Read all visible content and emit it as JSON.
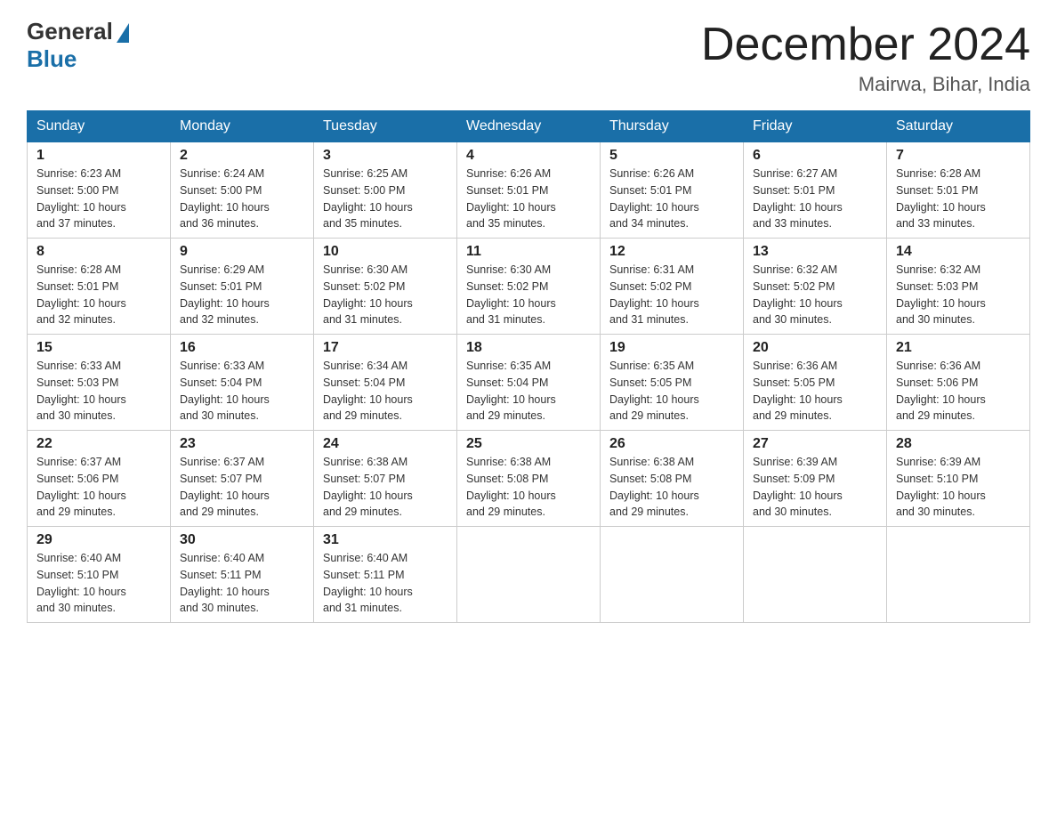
{
  "header": {
    "logo_general": "General",
    "logo_blue": "Blue",
    "month_title": "December 2024",
    "location": "Mairwa, Bihar, India"
  },
  "weekdays": [
    "Sunday",
    "Monday",
    "Tuesday",
    "Wednesday",
    "Thursday",
    "Friday",
    "Saturday"
  ],
  "weeks": [
    [
      {
        "day": "1",
        "sunrise": "6:23 AM",
        "sunset": "5:00 PM",
        "daylight": "10 hours and 37 minutes."
      },
      {
        "day": "2",
        "sunrise": "6:24 AM",
        "sunset": "5:00 PM",
        "daylight": "10 hours and 36 minutes."
      },
      {
        "day": "3",
        "sunrise": "6:25 AM",
        "sunset": "5:00 PM",
        "daylight": "10 hours and 35 minutes."
      },
      {
        "day": "4",
        "sunrise": "6:26 AM",
        "sunset": "5:01 PM",
        "daylight": "10 hours and 35 minutes."
      },
      {
        "day": "5",
        "sunrise": "6:26 AM",
        "sunset": "5:01 PM",
        "daylight": "10 hours and 34 minutes."
      },
      {
        "day": "6",
        "sunrise": "6:27 AM",
        "sunset": "5:01 PM",
        "daylight": "10 hours and 33 minutes."
      },
      {
        "day": "7",
        "sunrise": "6:28 AM",
        "sunset": "5:01 PM",
        "daylight": "10 hours and 33 minutes."
      }
    ],
    [
      {
        "day": "8",
        "sunrise": "6:28 AM",
        "sunset": "5:01 PM",
        "daylight": "10 hours and 32 minutes."
      },
      {
        "day": "9",
        "sunrise": "6:29 AM",
        "sunset": "5:01 PM",
        "daylight": "10 hours and 32 minutes."
      },
      {
        "day": "10",
        "sunrise": "6:30 AM",
        "sunset": "5:02 PM",
        "daylight": "10 hours and 31 minutes."
      },
      {
        "day": "11",
        "sunrise": "6:30 AM",
        "sunset": "5:02 PM",
        "daylight": "10 hours and 31 minutes."
      },
      {
        "day": "12",
        "sunrise": "6:31 AM",
        "sunset": "5:02 PM",
        "daylight": "10 hours and 31 minutes."
      },
      {
        "day": "13",
        "sunrise": "6:32 AM",
        "sunset": "5:02 PM",
        "daylight": "10 hours and 30 minutes."
      },
      {
        "day": "14",
        "sunrise": "6:32 AM",
        "sunset": "5:03 PM",
        "daylight": "10 hours and 30 minutes."
      }
    ],
    [
      {
        "day": "15",
        "sunrise": "6:33 AM",
        "sunset": "5:03 PM",
        "daylight": "10 hours and 30 minutes."
      },
      {
        "day": "16",
        "sunrise": "6:33 AM",
        "sunset": "5:04 PM",
        "daylight": "10 hours and 30 minutes."
      },
      {
        "day": "17",
        "sunrise": "6:34 AM",
        "sunset": "5:04 PM",
        "daylight": "10 hours and 29 minutes."
      },
      {
        "day": "18",
        "sunrise": "6:35 AM",
        "sunset": "5:04 PM",
        "daylight": "10 hours and 29 minutes."
      },
      {
        "day": "19",
        "sunrise": "6:35 AM",
        "sunset": "5:05 PM",
        "daylight": "10 hours and 29 minutes."
      },
      {
        "day": "20",
        "sunrise": "6:36 AM",
        "sunset": "5:05 PM",
        "daylight": "10 hours and 29 minutes."
      },
      {
        "day": "21",
        "sunrise": "6:36 AM",
        "sunset": "5:06 PM",
        "daylight": "10 hours and 29 minutes."
      }
    ],
    [
      {
        "day": "22",
        "sunrise": "6:37 AM",
        "sunset": "5:06 PM",
        "daylight": "10 hours and 29 minutes."
      },
      {
        "day": "23",
        "sunrise": "6:37 AM",
        "sunset": "5:07 PM",
        "daylight": "10 hours and 29 minutes."
      },
      {
        "day": "24",
        "sunrise": "6:38 AM",
        "sunset": "5:07 PM",
        "daylight": "10 hours and 29 minutes."
      },
      {
        "day": "25",
        "sunrise": "6:38 AM",
        "sunset": "5:08 PM",
        "daylight": "10 hours and 29 minutes."
      },
      {
        "day": "26",
        "sunrise": "6:38 AM",
        "sunset": "5:08 PM",
        "daylight": "10 hours and 29 minutes."
      },
      {
        "day": "27",
        "sunrise": "6:39 AM",
        "sunset": "5:09 PM",
        "daylight": "10 hours and 30 minutes."
      },
      {
        "day": "28",
        "sunrise": "6:39 AM",
        "sunset": "5:10 PM",
        "daylight": "10 hours and 30 minutes."
      }
    ],
    [
      {
        "day": "29",
        "sunrise": "6:40 AM",
        "sunset": "5:10 PM",
        "daylight": "10 hours and 30 minutes."
      },
      {
        "day": "30",
        "sunrise": "6:40 AM",
        "sunset": "5:11 PM",
        "daylight": "10 hours and 30 minutes."
      },
      {
        "day": "31",
        "sunrise": "6:40 AM",
        "sunset": "5:11 PM",
        "daylight": "10 hours and 31 minutes."
      },
      null,
      null,
      null,
      null
    ]
  ],
  "labels": {
    "sunrise": "Sunrise:",
    "sunset": "Sunset:",
    "daylight": "Daylight:"
  }
}
